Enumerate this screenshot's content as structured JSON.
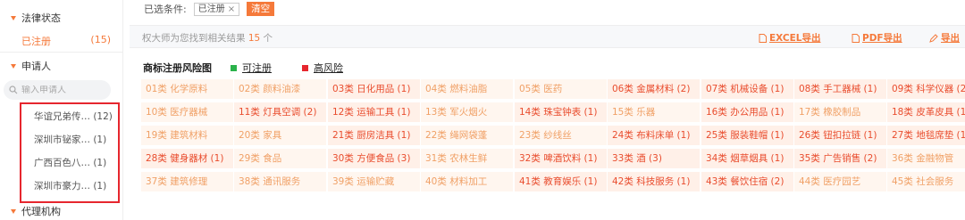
{
  "sidebar": {
    "status_header": "法律状态",
    "status_item": {
      "label": "已注册",
      "count": "(15)"
    },
    "applicant_header": "申请人",
    "search_placeholder": "输入申请人",
    "applicants": [
      "华谊兄弟传… (12)",
      "深圳市铋家… (1)",
      "广西百色八… (1)",
      "深圳市豪力… (1)"
    ],
    "agency_header": "代理机构"
  },
  "filter": {
    "label": "已选条件:",
    "chip": "已注册",
    "chip_close": "×",
    "clear": "清空"
  },
  "results": {
    "prefix": "权大师为您找到相关结果 ",
    "count": "15",
    "suffix": " 个",
    "export_excel": "EXCEL导出",
    "export_pdf": "PDF导出",
    "export_more": "导出"
  },
  "risk": {
    "title": "商标注册风险图",
    "legend_ok": "可注册",
    "legend_risk": "高风险",
    "color_ok": "#2ab24a",
    "color_risk": "#e6262e"
  },
  "classes": [
    [
      "01类 化学原料",
      "02类 颜料油漆",
      "03类 日化用品 (1)",
      "04类 燃料油脂",
      "05类 医药",
      "06类 金属材料 (2)",
      "07类 机械设备 (1)",
      "08类 手工器械 (1)",
      "09类 科学仪器 (2)"
    ],
    [
      "10类 医疗器械",
      "11类 灯具空调 (2)",
      "12类 运输工具 (1)",
      "13类 军火烟火",
      "14类 珠宝钟表 (1)",
      "15类 乐器",
      "16类 办公用品 (1)",
      "17类 橡胶制品",
      "18类 皮革皮具 (1)"
    ],
    [
      "19类 建筑材料",
      "20类 家具",
      "21类 厨房洁具 (1)",
      "22类 绳网袋蓬",
      "23类 纱线丝",
      "24类 布料床单 (1)",
      "25类 服装鞋帽 (1)",
      "26类 钮扣拉链 (1)",
      "27类 地毯席垫 (1)"
    ],
    [
      "28类 健身器材 (1)",
      "29类 食品",
      "30类 方便食品 (3)",
      "31类 农林生鲜",
      "32类 啤酒饮料 (1)",
      "33类 酒 (3)",
      "34类 烟草烟具 (1)",
      "35类 广告销售 (2)",
      "36类 金融物管"
    ],
    [
      "37类 建筑修理",
      "38类 通讯服务",
      "39类 运输贮藏",
      "40类 材料加工",
      "41类 教育娱乐 (1)",
      "42类 科技服务 (1)",
      "43类 餐饮住宿 (2)",
      "44类 医疗园艺",
      "45类 社会服务"
    ]
  ]
}
